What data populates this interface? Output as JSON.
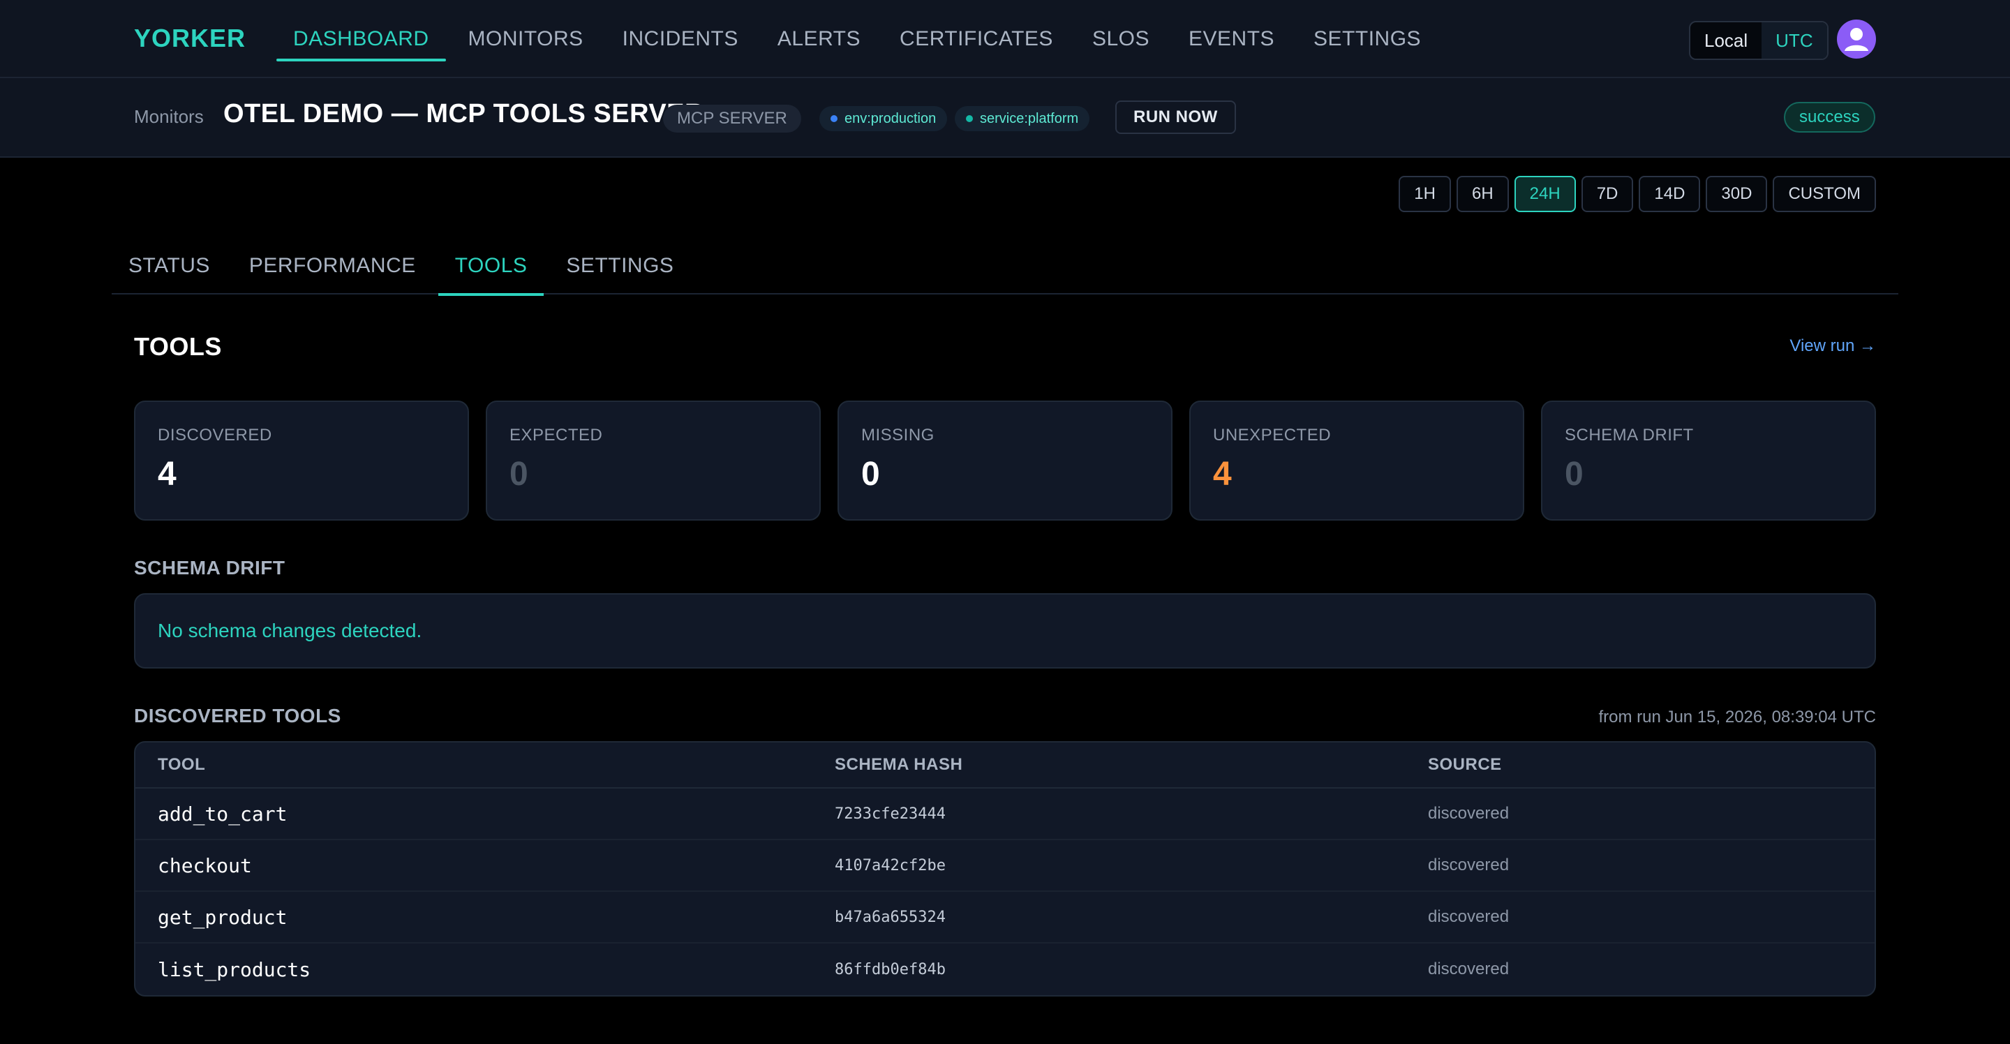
{
  "nav": {
    "brand": "YORKER",
    "links": [
      "DASHBOARD",
      "MONITORS",
      "INCIDENTS",
      "ALERTS",
      "CERTIFICATES",
      "SLOS",
      "EVENTS",
      "SETTINGS"
    ],
    "active": "DASHBOARD",
    "tz_local": "Local",
    "tz_utc": "UTC"
  },
  "header": {
    "breadcrumb": "Monitors",
    "title": "OTEL DEMO — MCP TOOLS SERVER",
    "type": "MCP SERVER",
    "tags": [
      {
        "label": "env:production",
        "color": "#3b82f6"
      },
      {
        "label": "service:platform",
        "color": "#14b8a6"
      }
    ],
    "run_now": "RUN NOW",
    "status": "success"
  },
  "ranges": [
    "1H",
    "6H",
    "24H",
    "7D",
    "14D",
    "30D",
    "CUSTOM"
  ],
  "active_range": "24H",
  "tabs": [
    "STATUS",
    "PERFORMANCE",
    "TOOLS",
    "SETTINGS"
  ],
  "active_tab": "TOOLS",
  "section": {
    "title": "TOOLS",
    "view_run": "View run →"
  },
  "stats": [
    {
      "label": "DISCOVERED",
      "value": "4",
      "color": "#ffffff"
    },
    {
      "label": "EXPECTED",
      "value": "0",
      "color": "#4b5563"
    },
    {
      "label": "MISSING",
      "value": "0",
      "color": "#ffffff"
    },
    {
      "label": "UNEXPECTED",
      "value": "4",
      "color": "#fb923c"
    },
    {
      "label": "SCHEMA DRIFT",
      "value": "0",
      "color": "#4b5563"
    }
  ],
  "drift": {
    "title": "SCHEMA DRIFT",
    "message": "No schema changes detected."
  },
  "tools": {
    "title": "DISCOVERED TOOLS",
    "from_run": "from run Jun 15, 2026, 08:39:04 UTC",
    "columns": [
      "TOOL",
      "SCHEMA HASH",
      "SOURCE"
    ],
    "rows": [
      {
        "tool": "add_to_cart",
        "hash": "7233cfe23444",
        "source": "discovered"
      },
      {
        "tool": "checkout",
        "hash": "4107a42cf2be",
        "source": "discovered"
      },
      {
        "tool": "get_product",
        "hash": "b47a6a655324",
        "source": "discovered"
      },
      {
        "tool": "list_products",
        "hash": "86ffdb0ef84b",
        "source": "discovered"
      }
    ]
  }
}
